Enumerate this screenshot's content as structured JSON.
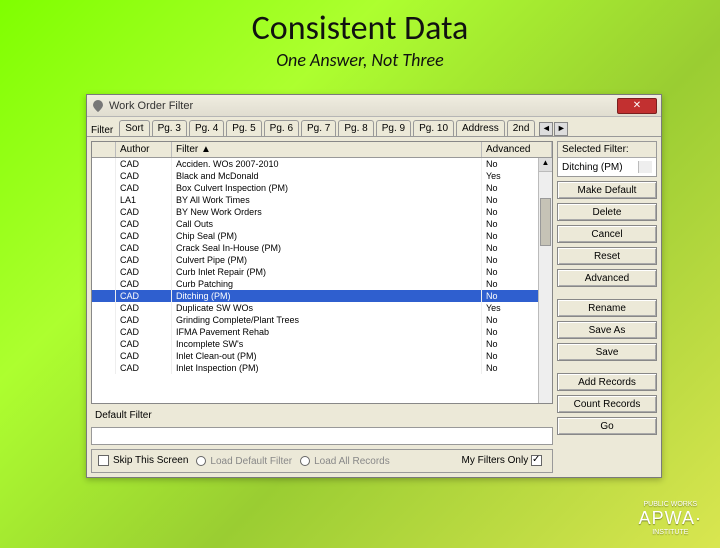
{
  "slide": {
    "title": "Consistent Data",
    "subtitle": "One Answer, Not Three"
  },
  "window": {
    "title": "Work Order Filter",
    "tabs_label": "Filter",
    "tabs": [
      "Sort",
      "Pg. 3",
      "Pg. 4",
      "Pg. 5",
      "Pg. 6",
      "Pg. 7",
      "Pg. 8",
      "Pg. 9",
      "Pg. 10",
      "Address",
      "2nd"
    ],
    "tab_scroll_left": "◄",
    "tab_scroll_right": "►"
  },
  "grid": {
    "cols": {
      "author": "Author",
      "filter": "Filter ▲",
      "advanced": "Advanced"
    },
    "rows": [
      {
        "author": "CAD",
        "filter": "Acciden. WOs 2007-2010",
        "adv": "No"
      },
      {
        "author": "CAD",
        "filter": "Black and McDonald",
        "adv": "Yes"
      },
      {
        "author": "CAD",
        "filter": "Box Culvert Inspection (PM)",
        "adv": "No"
      },
      {
        "author": "LA1",
        "filter": "BY All Work Times",
        "adv": "No"
      },
      {
        "author": "CAD",
        "filter": "BY New Work Orders",
        "adv": "No"
      },
      {
        "author": "CAD",
        "filter": "Call Outs",
        "adv": "No"
      },
      {
        "author": "CAD",
        "filter": "Chip Seal (PM)",
        "adv": "No"
      },
      {
        "author": "CAD",
        "filter": "Crack Seal In-House (PM)",
        "adv": "No"
      },
      {
        "author": "CAD",
        "filter": "Culvert Pipe (PM)",
        "adv": "No"
      },
      {
        "author": "CAD",
        "filter": "Curb Inlet Repair (PM)",
        "adv": "No"
      },
      {
        "author": "CAD",
        "filter": "Curb Patching",
        "adv": "No"
      },
      {
        "author": "CAD",
        "filter": "Ditching (PM)",
        "adv": "No",
        "selected": true
      },
      {
        "author": "CAD",
        "filter": "Duplicate SW WOs",
        "adv": "Yes"
      },
      {
        "author": "CAD",
        "filter": "Grinding Complete/Plant Trees",
        "adv": "No"
      },
      {
        "author": "CAD",
        "filter": "IFMA Pavement Rehab",
        "adv": "No"
      },
      {
        "author": "CAD",
        "filter": "Incomplete SW's",
        "adv": "No"
      },
      {
        "author": "CAD",
        "filter": "Inlet Clean-out (PM)",
        "adv": "No"
      },
      {
        "author": "CAD",
        "filter": "Inlet Inspection (PM)",
        "adv": "No"
      }
    ]
  },
  "default_filter_label": "Default Filter",
  "bottom": {
    "skip": "Skip This Screen",
    "opt_default": "Load Default Filter",
    "opt_all": "Load All Records",
    "my_only": "My Filters Only"
  },
  "side": {
    "selected_filter_label": "Selected Filter:",
    "selected_filter_value": "Ditching (PM)",
    "buttons": {
      "make_default": "Make Default",
      "delete": "Delete",
      "cancel": "Cancel",
      "reset": "Reset",
      "advanced": "Advanced",
      "rename": "Rename",
      "save_as": "Save As",
      "save": "Save",
      "add_records": "Add Records",
      "count_records": "Count Records",
      "go": "Go"
    }
  },
  "logo": {
    "top": "PUBLIC WORKS",
    "main": "APWA·",
    "bottom": "INSTITUTE"
  }
}
